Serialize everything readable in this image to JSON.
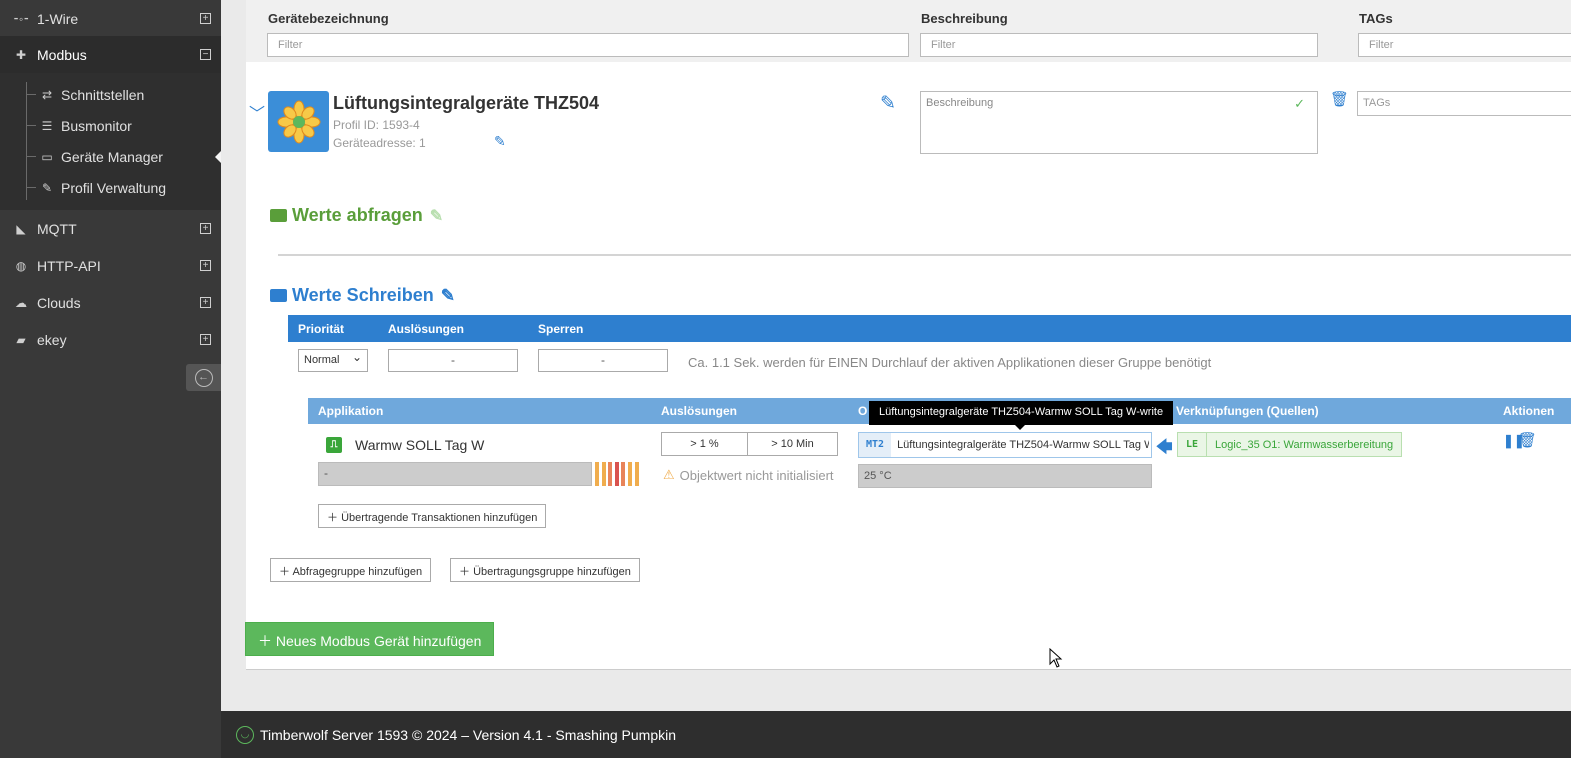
{
  "sidebar": {
    "items": [
      {
        "label": "1-Wire",
        "icon": "onewire-icon",
        "toggle": "+"
      },
      {
        "label": "Modbus",
        "icon": "puzzle-icon",
        "toggle": "−"
      },
      {
        "label": "MQTT",
        "icon": "rss-icon",
        "toggle": "+"
      },
      {
        "label": "HTTP-API",
        "icon": "globe-icon",
        "toggle": "+"
      },
      {
        "label": "Clouds",
        "icon": "cloud-icon",
        "toggle": "+"
      },
      {
        "label": "ekey",
        "icon": "fingerprint-icon",
        "toggle": "+"
      }
    ],
    "sub_items": [
      {
        "label": "Schnittstellen",
        "icon": "exchange-icon"
      },
      {
        "label": "Busmonitor",
        "icon": "list-icon"
      },
      {
        "label": "Geräte Manager",
        "icon": "laptop-icon"
      },
      {
        "label": "Profil Verwaltung",
        "icon": "edit-icon"
      }
    ],
    "collapse_glyph": "←"
  },
  "filters": {
    "headers": [
      "Gerätebezeichnung",
      "Beschreibung",
      "TAGs"
    ],
    "placeholders": [
      "Filter",
      "Filter",
      "Filter"
    ]
  },
  "device": {
    "title": "Lüftungsintegralgeräte THZ504",
    "profile_id": "Profil ID: 1593-4",
    "address": "Geräteadresse: 1",
    "description_placeholder": "Beschreibung",
    "tags_placeholder": "TAGs"
  },
  "sections": {
    "read_title": "Werte abfragen",
    "write_title": "Werte Schreiben"
  },
  "write_group": {
    "headers": [
      "Priorität",
      "Auslösungen",
      "Sperren"
    ],
    "priority": "Normal",
    "triggers": "-",
    "locks": "-",
    "note": "Ca. 1.1 Sek. werden für EINEN Durchlauf der aktiven Applikationen dieser Gruppe benötigt"
  },
  "app_table": {
    "headers": [
      "Applikation",
      "Auslösungen",
      "O",
      "Verknüpfungen (Quellen)",
      "Aktionen"
    ],
    "row": {
      "app_icon_glyph": "⎍",
      "app_name": "Warmw SOLL Tag W",
      "status_value": "-",
      "trigger_percent": "> 1 %",
      "trigger_time": "> 10 Min",
      "warning": "Objektwert nicht initialisiert",
      "object_tag": "MT2",
      "object_name": "Lüftungsintegralgeräte THZ504-Warmw SOLL Tag W-write",
      "object_value": "25 °C",
      "link_tag": "LE",
      "link_name": "Logic_35 O1: Warmwasserbereitung"
    },
    "stripe_colors": [
      "#f0ad4e",
      "#f0ad4e",
      "#e8845a",
      "#d9534f",
      "#e8845a",
      "#f0ad4e",
      "#f0ad4e"
    ],
    "tooltip": "Lüftungsintegralgeräte THZ504-Warmw SOLL Tag W-write"
  },
  "buttons": {
    "add_transaction": "Übertragende Transaktionen hinzufügen",
    "add_query_group": "Abfragegruppe hinzufügen",
    "add_write_group": "Übertragungsgruppe hinzufügen",
    "add_device": "Neues Modbus Gerät hinzufügen"
  },
  "footer": {
    "text": "Timberwolf Server 1593 © 2024 – Version 4.1 - Smashing Pumpkin"
  },
  "colors": {
    "accent_blue": "#2e7fcf",
    "green": "#5cb85c",
    "read_green": "#5a9e3a",
    "sidebar_bg": "#393939"
  }
}
